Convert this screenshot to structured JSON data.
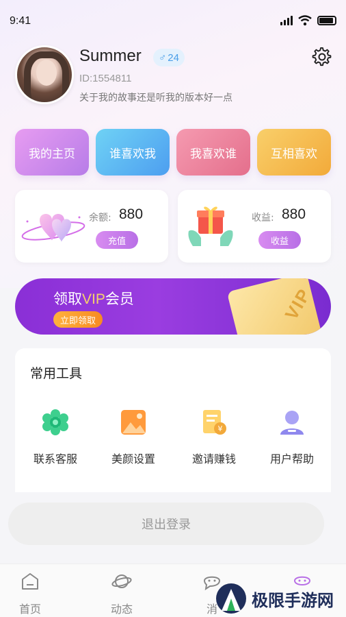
{
  "status_bar": {
    "time": "9:41"
  },
  "profile": {
    "name": "Summer",
    "gender_symbol": "♂",
    "age": "24",
    "id_text": "ID:1554811",
    "bio": "关于我的故事还是听我的版本好一点"
  },
  "quick_menu": [
    {
      "label": "我的主页"
    },
    {
      "label": "谁喜欢我"
    },
    {
      "label": "我喜欢谁"
    },
    {
      "label": "互相喜欢"
    }
  ],
  "wallet": {
    "balance_label": "余额:",
    "balance_value": "880",
    "recharge_label": "充值",
    "income_label": "收益:",
    "income_value": "880",
    "income_button": "收益"
  },
  "vip_banner": {
    "title_prefix": "领取",
    "title_vip": "VIP",
    "title_suffix": "会员",
    "button": "立即领取",
    "card_text": "VIP"
  },
  "tools": {
    "title": "常用工具",
    "items": [
      {
        "label": "联系客服",
        "icon": "customer-service-icon"
      },
      {
        "label": "美颜设置",
        "icon": "beauty-settings-icon"
      },
      {
        "label": "邀请赚钱",
        "icon": "invite-earn-icon"
      },
      {
        "label": "用户帮助",
        "icon": "user-help-icon"
      }
    ]
  },
  "logout": {
    "label": "退出登录"
  },
  "tabbar": [
    {
      "label": "首页",
      "icon": "home-icon"
    },
    {
      "label": "动态",
      "icon": "planet-icon"
    },
    {
      "label": "消",
      "icon": "message-icon"
    },
    {
      "label": "",
      "icon": "profile-icon"
    }
  ],
  "watermark": {
    "text": "极限手游网"
  },
  "colors": {
    "accent_purple": "#b86fe6",
    "vip_gold": "#f6d26a",
    "banner_purple": "#8a2fd6"
  }
}
